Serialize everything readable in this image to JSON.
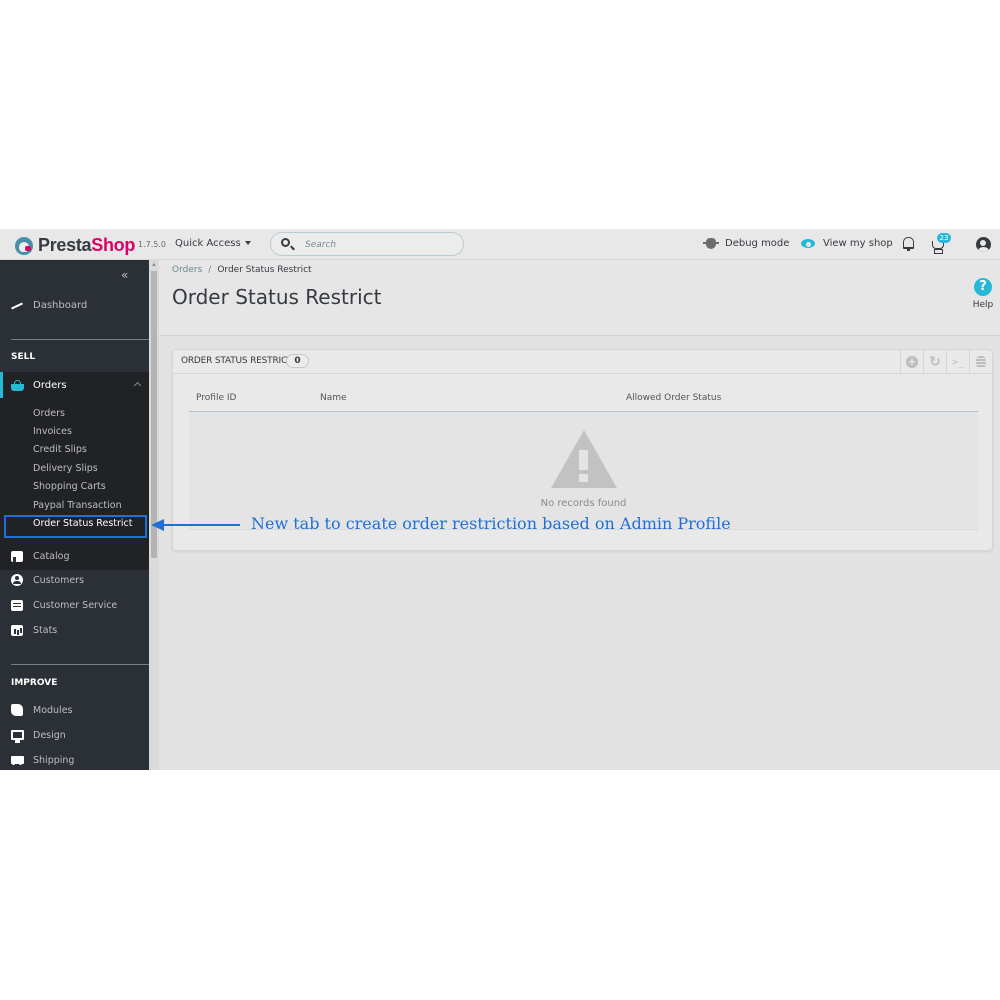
{
  "header": {
    "brand_part1": "Presta",
    "brand_part2": "Shop",
    "version": "1.7.5.0",
    "quick_access_label": "Quick Access",
    "search_placeholder": "Search",
    "debug_mode_label": "Debug mode",
    "view_shop_label": "View my shop",
    "notification_count": "23"
  },
  "sidebar": {
    "collapse_label": "«",
    "dashboard_label": "Dashboard",
    "sections": [
      {
        "title": "SELL"
      },
      {
        "title": "IMPROVE"
      }
    ],
    "orders": {
      "label": "Orders",
      "submenu": [
        {
          "label": "Orders"
        },
        {
          "label": "Invoices"
        },
        {
          "label": "Credit Slips"
        },
        {
          "label": "Delivery Slips"
        },
        {
          "label": "Shopping Carts"
        },
        {
          "label": "Paypal Transaction"
        },
        {
          "label": "Order Status Restrict"
        }
      ]
    },
    "sell_items": [
      {
        "label": "Catalog",
        "icon": "store-icon"
      },
      {
        "label": "Customers",
        "icon": "customer-icon"
      },
      {
        "label": "Customer Service",
        "icon": "chat-icon"
      },
      {
        "label": "Stats",
        "icon": "stats-icon"
      }
    ],
    "improve_items": [
      {
        "label": "Modules",
        "icon": "puzzle-icon"
      },
      {
        "label": "Design",
        "icon": "monitor-icon"
      },
      {
        "label": "Shipping",
        "icon": "truck-icon"
      }
    ]
  },
  "page": {
    "breadcrumb": [
      "Orders",
      "Order Status Restrict"
    ],
    "breadcrumb_separator": "/",
    "title": "Order Status Restrict",
    "help_label": "Help",
    "help_icon": "?"
  },
  "panel": {
    "title": "ORDER STATUS RESTRICT",
    "count": "0",
    "columns": [
      "Profile ID",
      "Name",
      "Allowed Order Status"
    ],
    "empty_message": "No records found",
    "tools": [
      "add-new",
      "refresh-list",
      "show-sql-query",
      "export-sql-manager"
    ]
  },
  "annotation": {
    "text": "New tab to create order restriction based on Admin Profile",
    "color": "#1f6fd6"
  },
  "colors": {
    "accent": "#25b9d7",
    "brand_pink": "#df0067",
    "sidebar_bg": "#2b2f36"
  }
}
